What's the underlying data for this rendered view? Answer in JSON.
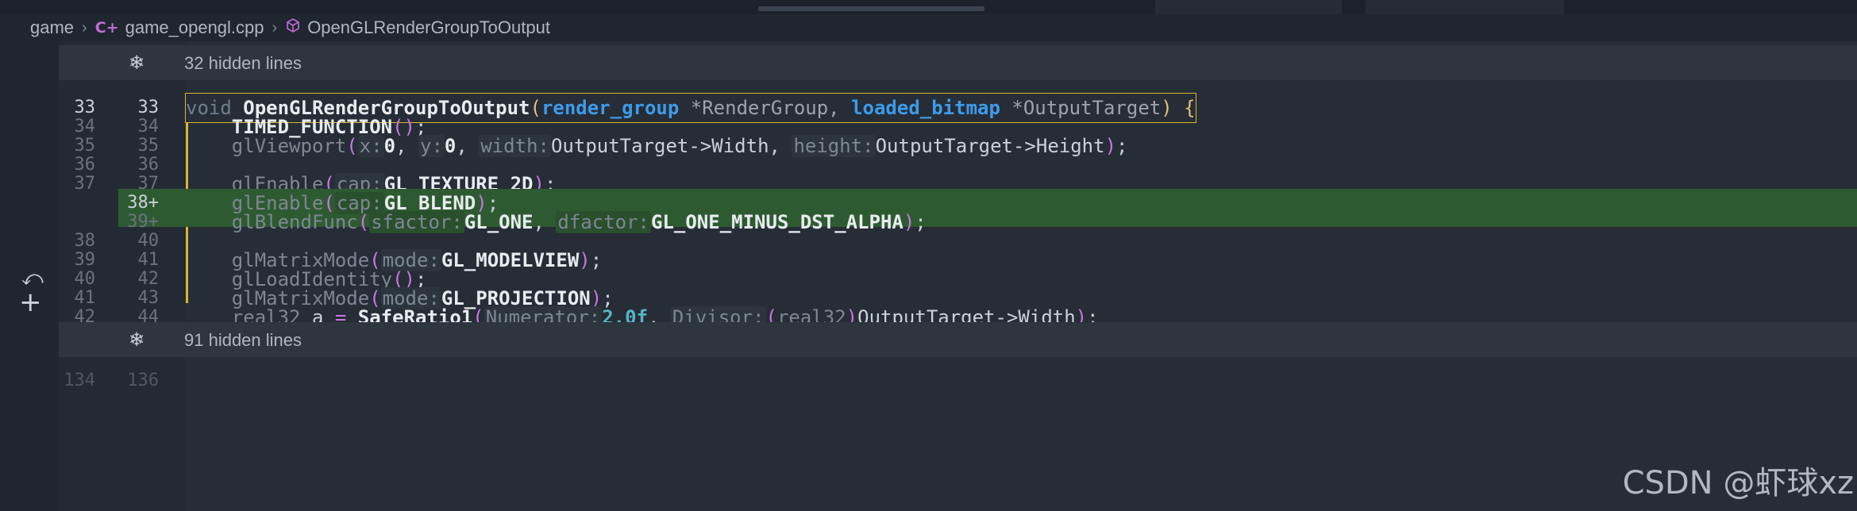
{
  "breadcrumb": {
    "folder": "game",
    "file": "game_opengl.cpp",
    "symbol": "OpenGLRenderGroupToOutput"
  },
  "hidden_top": "32 hidden lines",
  "hidden_bottom": "91 hidden lines",
  "lines": [
    {
      "old": "33",
      "new": "33"
    },
    {
      "old": "34",
      "new": "34"
    },
    {
      "old": "35",
      "new": "35"
    },
    {
      "old": "36",
      "new": "36"
    },
    {
      "old": "37",
      "new": "37"
    },
    {
      "old": "",
      "new": "38+"
    },
    {
      "old": "",
      "new": "39+"
    },
    {
      "old": "38",
      "new": "40"
    },
    {
      "old": "39",
      "new": "41"
    },
    {
      "old": "40",
      "new": "42"
    },
    {
      "old": "41",
      "new": "43"
    },
    {
      "old": "42",
      "new": "44"
    }
  ],
  "last_line": {
    "old": "134",
    "new": "136"
  },
  "code": {
    "l33": {
      "kw": "void",
      "fn": "OpenGLRenderGroupToOutput",
      "t1": "render_group",
      "p1": "*RenderGroup, ",
      "t2": "loaded_bitmap",
      "p2": "*OutputTarget"
    },
    "l34": {
      "fn": "TIMED_FUNCTION"
    },
    "l35": {
      "call": "glViewport",
      "h1": "x:",
      "v1": "0",
      "h2": "y:",
      "v2": "0",
      "h3": "width:",
      "v3": "OutputTarget->Width",
      "h4": "height:",
      "v4": "OutputTarget->Height"
    },
    "l37": {
      "call": "glEnable",
      "h": "cap:",
      "v": "GL_TEXTURE_2D"
    },
    "l38": {
      "call": "glEnable",
      "h": "cap:",
      "v": "GL_BLEND"
    },
    "l39": {
      "call": "glBlendFunc",
      "h1": "sfactor:",
      "v1": "GL_ONE",
      "h2": "dfactor:",
      "v2": "GL_ONE_MINUS_DST_ALPHA"
    },
    "l41": {
      "call": "glMatrixMode",
      "h": "mode:",
      "v": "GL_MODELVIEW"
    },
    "l42": {
      "call": "glLoadIdentity"
    },
    "l43": {
      "call": "glMatrixMode",
      "h": "mode:",
      "v": "GL_PROJECTION"
    },
    "l44": {
      "ty": "real32",
      "var": "a",
      "fn": "SafeRatio1",
      "h1": "Numerator:",
      "v1": "2.0f",
      "h2": "Divisor:",
      "cast": "real32",
      "v2": "OutputTarget->Width"
    }
  },
  "watermark": "CSDN @虾球xz",
  "colors": {
    "added_bg": "#2e5a31",
    "change_bar": "#d9b82f",
    "type": "#3d9be9"
  }
}
